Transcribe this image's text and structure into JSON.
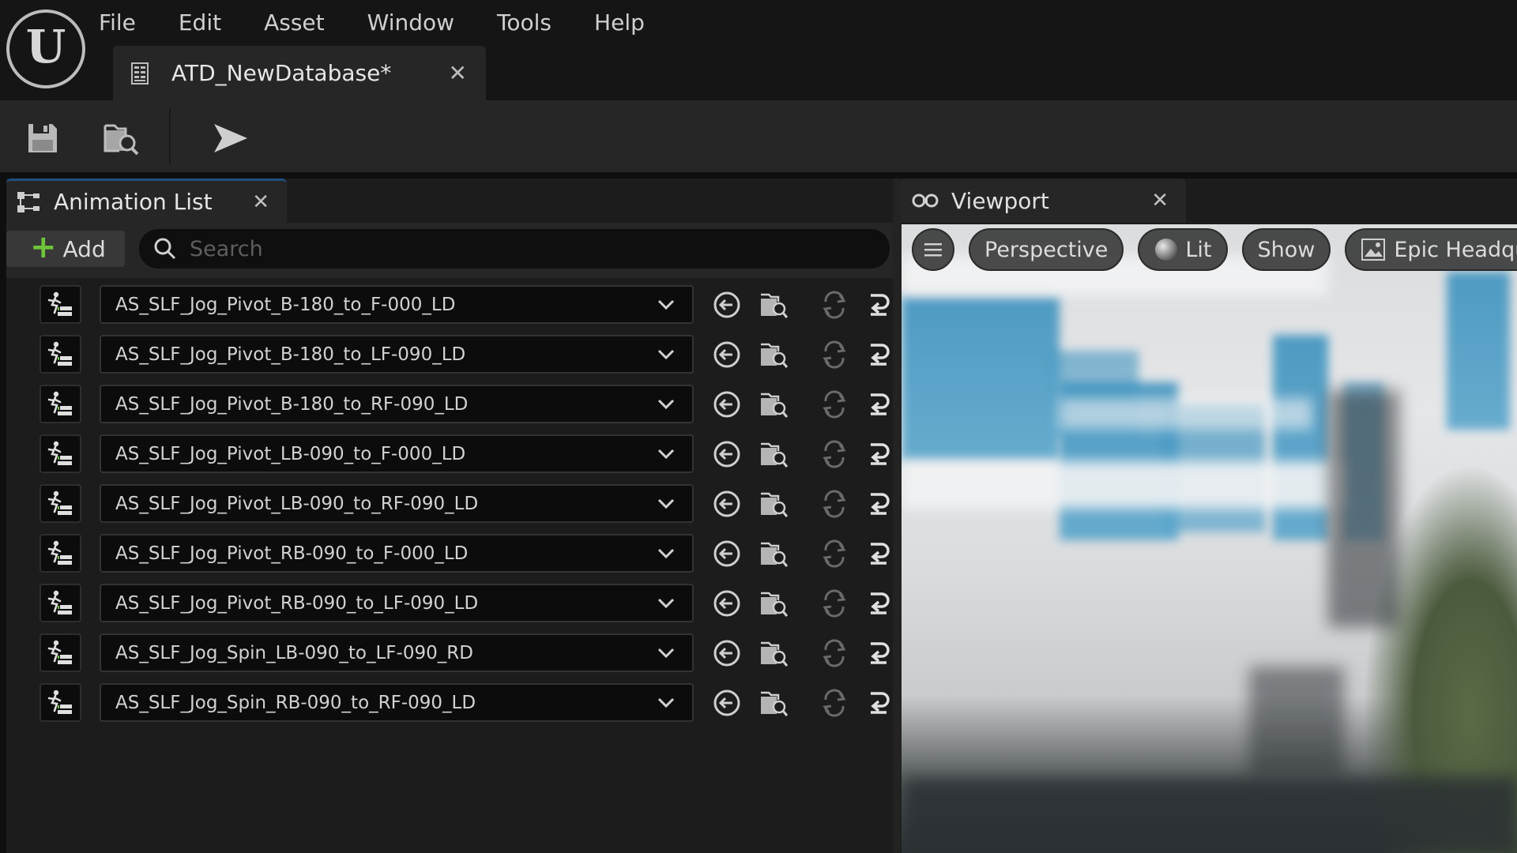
{
  "menu": {
    "items": [
      {
        "label": "File"
      },
      {
        "label": "Edit"
      },
      {
        "label": "Asset"
      },
      {
        "label": "Window"
      },
      {
        "label": "Tools"
      },
      {
        "label": "Help"
      }
    ]
  },
  "document_tab": {
    "label": "ATD_NewDatabase*",
    "icon": "database-icon"
  },
  "toolbar": {
    "buttons": [
      {
        "icon": "save-icon"
      },
      {
        "icon": "browse-folder-icon"
      },
      {
        "icon": "play-arrow-icon"
      }
    ]
  },
  "animation_panel": {
    "tab_label": "Animation List",
    "add_label": "Add",
    "search_placeholder": "Search",
    "items": [
      {
        "asset": "AS_SLF_Jog_Pivot_B-180_to_F-000_LD"
      },
      {
        "asset": "AS_SLF_Jog_Pivot_B-180_to_LF-090_LD"
      },
      {
        "asset": "AS_SLF_Jog_Pivot_B-180_to_RF-090_LD"
      },
      {
        "asset": "AS_SLF_Jog_Pivot_LB-090_to_F-000_LD"
      },
      {
        "asset": "AS_SLF_Jog_Pivot_LB-090_to_RF-090_LD"
      },
      {
        "asset": "AS_SLF_Jog_Pivot_RB-090_to_F-000_LD"
      },
      {
        "asset": "AS_SLF_Jog_Pivot_RB-090_to_LF-090_LD"
      },
      {
        "asset": "AS_SLF_Jog_Spin_LB-090_to_LF-090_RD"
      },
      {
        "asset": "AS_SLF_Jog_Spin_RB-090_to_RF-090_LD"
      }
    ]
  },
  "viewport_panel": {
    "tab_label": "Viewport",
    "toolbar": {
      "perspective": "Perspective",
      "lit": "Lit",
      "show": "Show",
      "environment": "Epic Headqua"
    }
  },
  "colors": {
    "accent_green": "#6ec43a",
    "tab_active_border": "#1f4f83",
    "panel_bg": "#1c1c1c"
  }
}
